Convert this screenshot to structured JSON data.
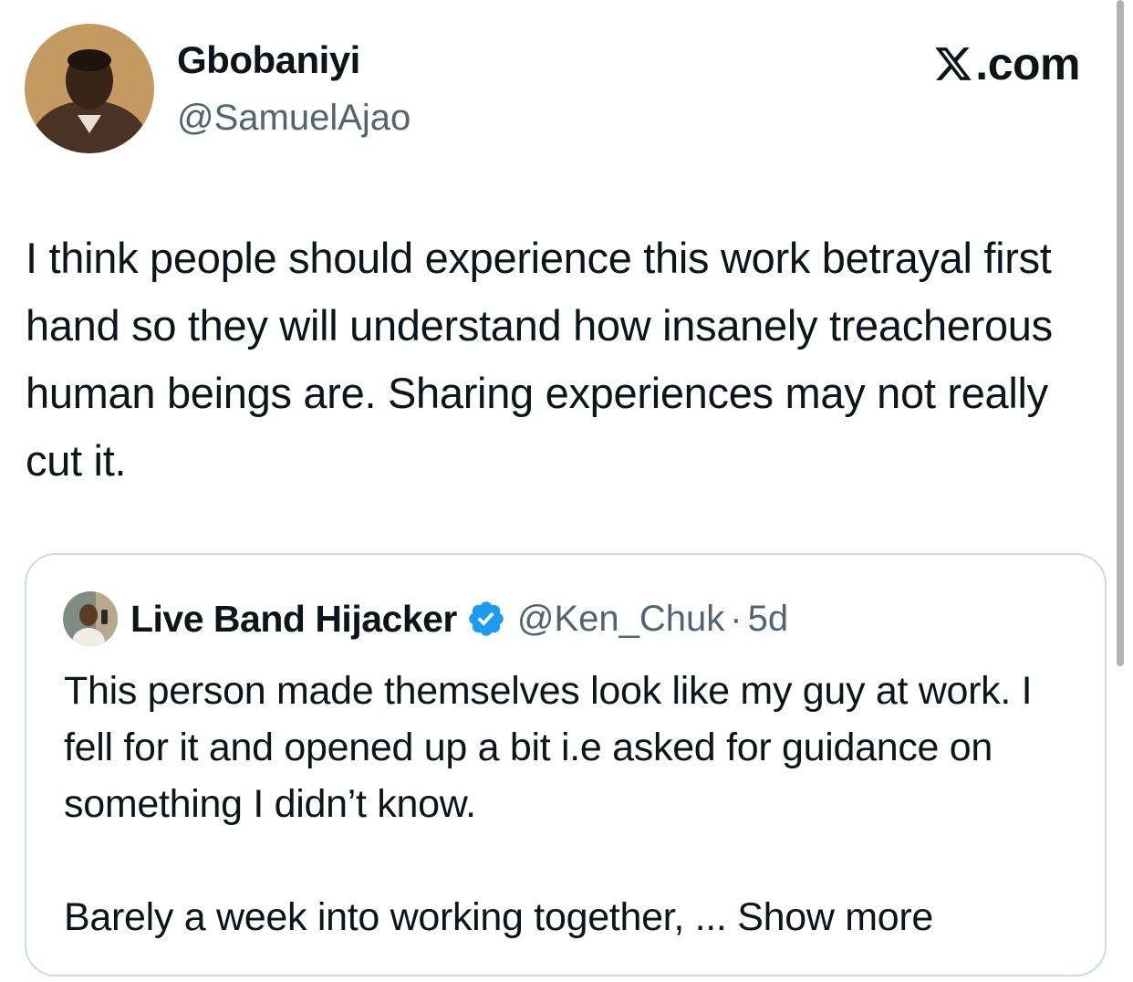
{
  "author": {
    "display_name": "Gbobaniyi",
    "handle": "@SamuelAjao",
    "avatar_icon": "person-avatar"
  },
  "brand": {
    "icon": "x-logo-icon",
    "suffix": ".com"
  },
  "tweet": {
    "text": "I think people should experience this work betrayal first hand so they will understand how insanely treacherous human beings are. Sharing experiences may not really cut it."
  },
  "quote": {
    "display_name": "Live Band Hijacker",
    "verified": true,
    "verified_color": "#1d9bf0",
    "handle": "@Ken_Chuk",
    "separator": "·",
    "time": "5d",
    "paragraph1": "This person made themselves look like my guy at work. I fell for it and opened up a bit i.e asked for guidance on something I didn’t know.",
    "paragraph2_prefix": "Barely a week into working together, ... ",
    "show_more": "Show more"
  },
  "colors": {
    "text_primary": "#0f1419",
    "text_secondary": "#536471",
    "border": "#cfd9de"
  }
}
